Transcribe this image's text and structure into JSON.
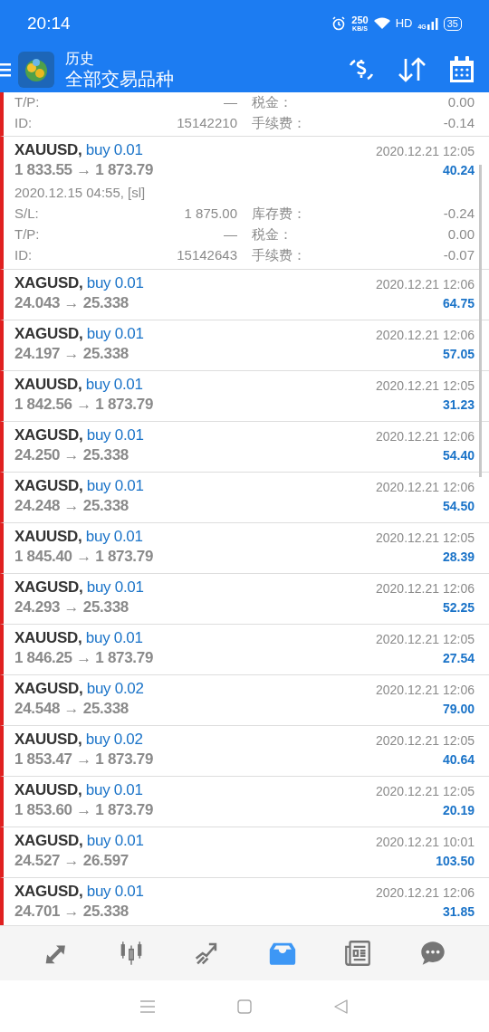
{
  "status_bar": {
    "time": "20:14",
    "speed": "250",
    "speed_unit": "KB/S",
    "network": "HD",
    "signal_label": "4G",
    "battery": "35"
  },
  "header": {
    "title": "历史",
    "subtitle": "全部交易品种"
  },
  "partial_details": [
    {
      "label": "T/P:",
      "value": "—",
      "label2": "税金：",
      "value2": "0.00"
    },
    {
      "label": "ID:",
      "value": "15142210",
      "label2": "手续费：",
      "value2": "-0.14"
    }
  ],
  "trades": [
    {
      "symbol": "XAUUSD,",
      "side": "buy 0.01",
      "prices": "1 833.55 → 1 873.79",
      "time": "2020.12.21 12:05",
      "profit": "40.24",
      "expanded": true,
      "open_info": "2020.12.15 04:55, [sl]",
      "details": [
        {
          "label": "S/L:",
          "value": "1 875.00",
          "label2": "库存费：",
          "value2": "-0.24"
        },
        {
          "label": "T/P:",
          "value": "—",
          "label2": "税金：",
          "value2": "0.00"
        },
        {
          "label": "ID:",
          "value": "15142643",
          "label2": "手续费：",
          "value2": "-0.07"
        }
      ]
    },
    {
      "symbol": "XAGUSD,",
      "side": "buy 0.01",
      "prices": "24.043 → 25.338",
      "time": "2020.12.21 12:06",
      "profit": "64.75",
      "expanded": false
    },
    {
      "symbol": "XAGUSD,",
      "side": "buy 0.01",
      "prices": "24.197 → 25.338",
      "time": "2020.12.21 12:06",
      "profit": "57.05",
      "expanded": false
    },
    {
      "symbol": "XAUUSD,",
      "side": "buy 0.01",
      "prices": "1 842.56 → 1 873.79",
      "time": "2020.12.21 12:05",
      "profit": "31.23",
      "expanded": false
    },
    {
      "symbol": "XAGUSD,",
      "side": "buy 0.01",
      "prices": "24.250 → 25.338",
      "time": "2020.12.21 12:06",
      "profit": "54.40",
      "expanded": false
    },
    {
      "symbol": "XAGUSD,",
      "side": "buy 0.01",
      "prices": "24.248 → 25.338",
      "time": "2020.12.21 12:06",
      "profit": "54.50",
      "expanded": false
    },
    {
      "symbol": "XAUUSD,",
      "side": "buy 0.01",
      "prices": "1 845.40 → 1 873.79",
      "time": "2020.12.21 12:05",
      "profit": "28.39",
      "expanded": false
    },
    {
      "symbol": "XAGUSD,",
      "side": "buy 0.01",
      "prices": "24.293 → 25.338",
      "time": "2020.12.21 12:06",
      "profit": "52.25",
      "expanded": false
    },
    {
      "symbol": "XAUUSD,",
      "side": "buy 0.01",
      "prices": "1 846.25 → 1 873.79",
      "time": "2020.12.21 12:05",
      "profit": "27.54",
      "expanded": false
    },
    {
      "symbol": "XAGUSD,",
      "side": "buy 0.02",
      "prices": "24.548 → 25.338",
      "time": "2020.12.21 12:06",
      "profit": "79.00",
      "expanded": false
    },
    {
      "symbol": "XAUUSD,",
      "side": "buy 0.02",
      "prices": "1 853.47 → 1 873.79",
      "time": "2020.12.21 12:05",
      "profit": "40.64",
      "expanded": false
    },
    {
      "symbol": "XAUUSD,",
      "side": "buy 0.01",
      "prices": "1 853.60 → 1 873.79",
      "time": "2020.12.21 12:05",
      "profit": "20.19",
      "expanded": false
    },
    {
      "symbol": "XAGUSD,",
      "side": "buy 0.01",
      "prices": "24.527 → 26.597",
      "time": "2020.12.21 10:01",
      "profit": "103.50",
      "expanded": false
    },
    {
      "symbol": "XAGUSD,",
      "side": "buy 0.01",
      "prices": "24.701 → 25.338",
      "time": "2020.12.21 12:06",
      "profit": "31.85",
      "expanded": false
    }
  ],
  "tab_bar": [
    {
      "kind": "trade",
      "selected": false
    },
    {
      "kind": "chart",
      "selected": false
    },
    {
      "kind": "trend",
      "selected": false
    },
    {
      "kind": "history",
      "selected": true
    },
    {
      "kind": "news",
      "selected": false
    },
    {
      "kind": "chat",
      "selected": false
    }
  ]
}
